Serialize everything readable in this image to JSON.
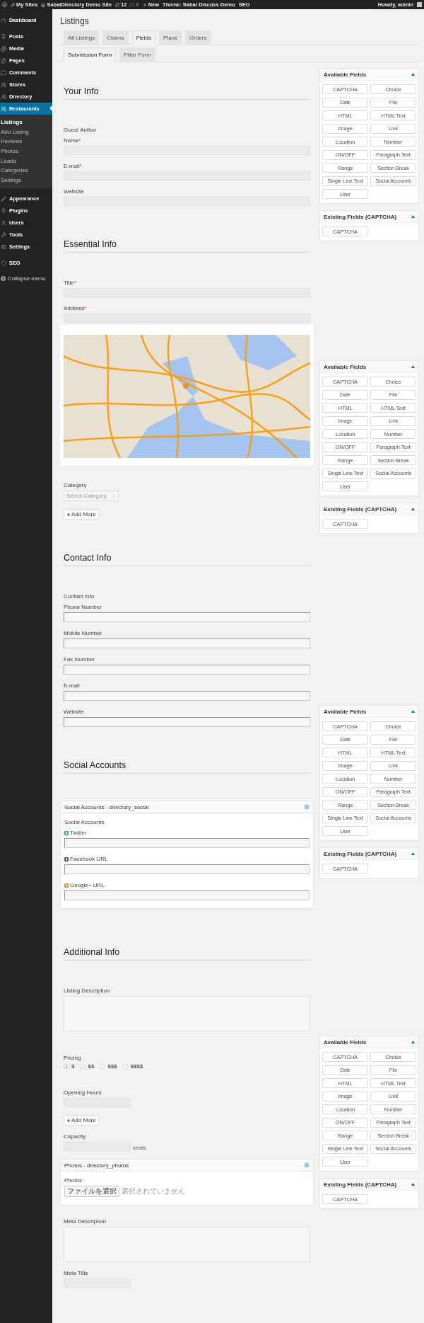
{
  "admin_bar": {
    "my_sites": "My Sites",
    "site": "SabaiDirectory Demo Site",
    "updates": "12",
    "comments": "0",
    "new": "New",
    "theme": "Theme: Sabai Discuss Demo",
    "seo": "SEO",
    "greeting": "Howdy, admin"
  },
  "menu_groups": [
    [
      {
        "label": "Dashboard",
        "selected": false
      }
    ],
    [
      {
        "label": "Posts",
        "selected": false
      },
      {
        "label": "Media",
        "selected": false
      },
      {
        "label": "Pages",
        "selected": false
      },
      {
        "label": "Comments",
        "selected": false
      },
      {
        "label": "Stores",
        "selected": false
      },
      {
        "label": "Directory",
        "selected": false
      },
      {
        "label": "Restaurants",
        "selected": true,
        "children": [
          {
            "label": "Listings",
            "selected": true
          },
          {
            "label": "Add Listing",
            "selected": false
          },
          {
            "label": "Reviews",
            "selected": false
          },
          {
            "label": "Photos",
            "selected": false
          },
          {
            "label": "Leads",
            "selected": false
          },
          {
            "label": "Categories",
            "selected": false
          },
          {
            "label": "Settings",
            "selected": false
          }
        ]
      }
    ],
    [
      {
        "label": "Appearance",
        "selected": false
      },
      {
        "label": "Plugins",
        "selected": false
      },
      {
        "label": "Users",
        "selected": false
      },
      {
        "label": "Tools",
        "selected": false
      },
      {
        "label": "Settings",
        "selected": false
      }
    ],
    [
      {
        "label": "SEO",
        "selected": false
      }
    ]
  ],
  "collapse_menu": "Collapse menu",
  "page_title": "Listings",
  "tabs": [
    {
      "label": "All Listings",
      "selected": false
    },
    {
      "label": "Claims",
      "selected": false
    },
    {
      "label": "Fields",
      "selected": true
    },
    {
      "label": "Plans",
      "selected": false
    },
    {
      "label": "Orders",
      "selected": false
    }
  ],
  "sub_tabs": [
    {
      "label": "Submission Form",
      "selected": true
    },
    {
      "label": "Filter Form",
      "selected": false
    }
  ],
  "sections": [
    {
      "heading": "Your Info",
      "items": [
        {
          "kind": "group_label",
          "text": "Guest Author"
        },
        {
          "kind": "flat_field",
          "label": "Name",
          "required_mark": "*"
        },
        {
          "kind": "flat_field",
          "label": "E-mail",
          "required_mark": "*"
        },
        {
          "kind": "flat_field",
          "label": "Website"
        }
      ]
    },
    {
      "heading": "Essential Info",
      "items": [
        {
          "kind": "flat_field",
          "label": "Title",
          "required_mark": "*"
        },
        {
          "kind": "flat_field",
          "label": "Address",
          "required_mark": "*"
        },
        {
          "kind": "map"
        },
        {
          "kind": "select",
          "label": "Category",
          "placeholder": "Select Category"
        },
        {
          "kind": "add_more",
          "text": "Add More"
        }
      ]
    },
    {
      "heading": "Contact Info",
      "items": [
        {
          "kind": "group_label",
          "text": "Contact Info"
        },
        {
          "kind": "inset_field",
          "label": "Phone Number"
        },
        {
          "kind": "inset_field",
          "label": "Mobile Number"
        },
        {
          "kind": "inset_field",
          "label": "Fax Number"
        },
        {
          "kind": "inset_field",
          "label": "E-mail"
        },
        {
          "kind": "inset_field",
          "label": "Website"
        }
      ]
    },
    {
      "heading": "Social Accounts",
      "items": [
        {
          "kind": "card",
          "title": "Social Accounts - directory_social",
          "items": [
            {
              "kind": "group_label",
              "text": "Social Accounts"
            },
            {
              "kind": "twitter_field",
              "label": "Twitter"
            },
            {
              "kind": "facebook_field",
              "label": "Facebook URL"
            },
            {
              "kind": "google_field",
              "label": "Google+ URL"
            }
          ]
        }
      ]
    },
    {
      "heading": "Additional Info",
      "items": [
        {
          "kind": "textarea",
          "label": "Listing Description"
        },
        {
          "kind": "radio_group",
          "label": "Pricing",
          "options": [
            {
              "label": "$",
              "selected": true
            },
            {
              "label": "$$",
              "selected": false
            },
            {
              "label": "$$$",
              "selected": false
            },
            {
              "label": "$$$$",
              "selected": false
            }
          ]
        },
        {
          "kind": "short_field",
          "label": "Opening Hours"
        },
        {
          "kind": "add_more",
          "text": "Add More"
        },
        {
          "kind": "short_field",
          "label": "Capacity",
          "suffix": "seats"
        },
        {
          "kind": "card",
          "title": "Photos - directory_photos",
          "items": [
            {
              "kind": "file",
              "label": "Photos",
              "button": "ファイルを選択",
              "status": "選択されていません"
            }
          ]
        },
        {
          "kind": "textarea",
          "label": "Meta Descriptoin"
        },
        {
          "kind": "short_field",
          "label": "Meta Title"
        }
      ]
    }
  ],
  "palettes": [
    {
      "available_title": "Available Fields",
      "buttons": [
        "CAPTCHA",
        "Choice",
        "Date",
        "File",
        "HTML",
        "HTML Text",
        "Image",
        "Link",
        "Location",
        "Number",
        "ON/OFF",
        "Paragraph Text",
        "Range",
        "Section Break",
        "Single Line Text",
        "Social Accounts",
        "User"
      ],
      "existing_title": "Existing Fields (CAPTCHA)",
      "existing_buttons": [
        "CAPTCHA"
      ]
    },
    {
      "available_title": "Available Fields",
      "buttons": [
        "CAPTCHA",
        "Choice",
        "Date",
        "File",
        "HTML",
        "HTML Text",
        "Image",
        "Link",
        "Location",
        "Number",
        "ON/OFF",
        "Paragraph Text",
        "Range",
        "Section Break",
        "Single Line Text",
        "Social Accounts",
        "User"
      ],
      "existing_title": "Existing Fields (CAPTCHA)",
      "existing_buttons": [
        "CAPTCHA"
      ]
    },
    {
      "available_title": "Available Fields",
      "buttons": [
        "CAPTCHA",
        "Choice",
        "Date",
        "File",
        "HTML",
        "HTML Text",
        "Image",
        "Link",
        "Location",
        "Number",
        "ON/OFF",
        "Paragraph Text",
        "Range",
        "Section Break",
        "Single Line Text",
        "Social Accounts",
        "User"
      ],
      "existing_title": "Existing Fields (CAPTCHA)",
      "existing_buttons": [
        "CAPTCHA"
      ]
    },
    {
      "available_title": "Available Fields",
      "buttons": [
        "CAPTCHA",
        "Choice",
        "Date",
        "File",
        "HTML",
        "HTML Text",
        "Image",
        "Link",
        "Location",
        "Number",
        "ON/OFF",
        "Paragraph Text",
        "Range",
        "Section Break",
        "Single Line Text",
        "Social Accounts",
        "User"
      ],
      "existing_title": "Existing Fields (CAPTCHA)",
      "existing_buttons": [
        "CAPTCHA"
      ]
    }
  ]
}
